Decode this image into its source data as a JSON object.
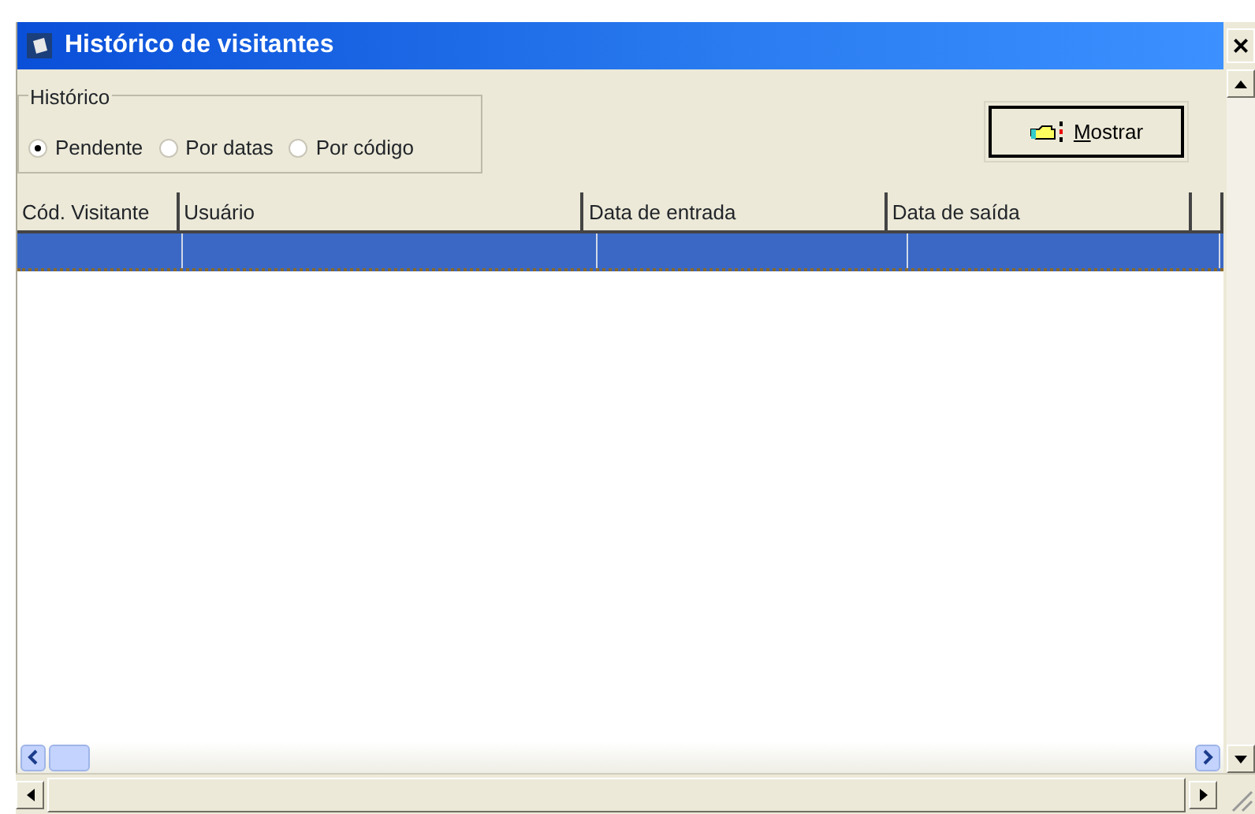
{
  "window": {
    "title": "Histórico de visitantes",
    "close": "×"
  },
  "filter": {
    "legend": "Histórico",
    "options": [
      {
        "label": "Pendente",
        "selected": true
      },
      {
        "label": "Por datas",
        "selected": false
      },
      {
        "label": "Por código",
        "selected": false
      }
    ]
  },
  "show_button": {
    "label": "Mostrar"
  },
  "table": {
    "columns": [
      "Cód. Visitante",
      "Usuário",
      "Data de entrada",
      "Data de saída"
    ],
    "rows": [
      {
        "selected": true
      }
    ]
  }
}
